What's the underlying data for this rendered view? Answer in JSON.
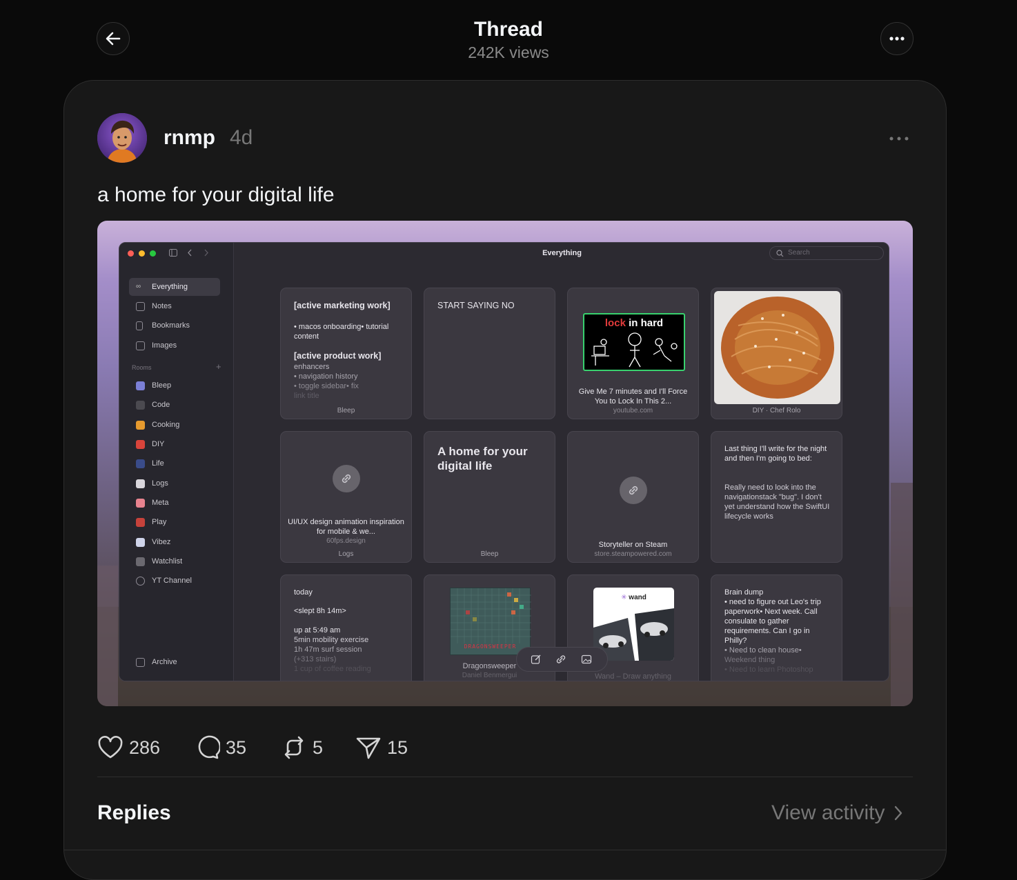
{
  "header": {
    "title": "Thread",
    "views": "242K views"
  },
  "post": {
    "username": "rnmp",
    "time": "4d",
    "text": "a home for your digital life",
    "likes": "286",
    "comments": "35",
    "reposts": "5",
    "shares": "15"
  },
  "app": {
    "window_title": "Everything",
    "search_placeholder": "Search",
    "sidebar_main": [
      "Everything",
      "Notes",
      "Bookmarks",
      "Images"
    ],
    "rooms_label": "Rooms",
    "rooms": [
      "Bleep",
      "Code",
      "Cooking",
      "DIY",
      "Life",
      "Logs",
      "Meta",
      "Play",
      "Vibez",
      "Watchlist",
      "YT Channel"
    ],
    "archive": "Archive",
    "tiles": {
      "t1": {
        "h1": "[active marketing work]",
        "l1": "• macos onboarding• tutorial content",
        "h2": "[active product work]",
        "l2": "enhancers",
        "l3": "• navigation history",
        "l4": "• toggle sidebar• fix",
        "l5": "link title",
        "foot": "Bleep"
      },
      "t2": {
        "text": "START SAYING NO"
      },
      "t3": {
        "thumb_red": "lock",
        "thumb_white": "in hard",
        "cap": "Give Me 7 minutes and I'll Force You to Lock In This 2...",
        "sub": "youtube.com"
      },
      "t4": {
        "foot": "DIY · Chef Rolo"
      },
      "t5": {
        "cap": "UI/UX design animation inspiration for mobile & we...",
        "sub": "60fps.design",
        "foot": "Logs"
      },
      "t6": {
        "text": "A home for your digital life",
        "foot": "Bleep"
      },
      "t7": {
        "cap": "Storyteller on Steam",
        "sub": "store.steampowered.com"
      },
      "t8": {
        "p1": "Last thing I'll write for the night and then I'm going to bed:",
        "p2": "Really need to look into the navigationstack \"bug\". I don't yet understand how the SwiftUI lifecycle works"
      },
      "t9": {
        "l1": "today",
        "l2": "<slept 8h 14m>",
        "l3": "up at 5:49 am",
        "l4": "5min mobility exercise",
        "l5": "1h 47m surf session",
        "l6": "(+313 stairs)",
        "l7": "1 cup of coffee reading"
      },
      "t10": {
        "thumb": "DRAGONSWEEPER",
        "cap": "Dragonsweeper",
        "sub": "Daniel Benmergui"
      },
      "t11": {
        "thumb": "wand",
        "cap": "Wand – Draw anything"
      },
      "t12": {
        "l1": "Brain dump",
        "l2": "• need to figure out Leo's trip paperwork• Next week. Call consulate to gather requirements. Can I go in Philly?",
        "l3": "• Need to clean house•",
        "l4": "Weekend thing",
        "l5": "• Need to learn Photoshop"
      }
    }
  },
  "footer": {
    "replies": "Replies",
    "view_activity": "View activity"
  },
  "colors": {
    "background": "#0a0a0a",
    "card": "#181818",
    "text": "#f3f5f7",
    "muted": "#777777"
  }
}
